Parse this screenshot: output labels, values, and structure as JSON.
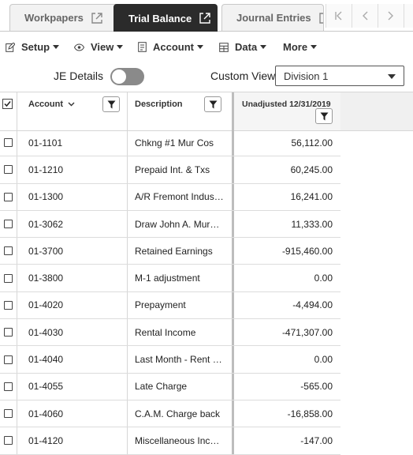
{
  "tabs": [
    {
      "label": "Workpapers",
      "active": false
    },
    {
      "label": "Trial Balance",
      "active": true
    },
    {
      "label": "Journal Entries",
      "active": false
    }
  ],
  "toolbar": {
    "setup": "Setup",
    "view": "View",
    "account": "Account",
    "data": "Data",
    "more": "More"
  },
  "options": {
    "je_details_label": "JE Details",
    "je_details_on": false,
    "custom_view_label": "Custom View",
    "custom_view_value": "Division 1"
  },
  "grid": {
    "columns": {
      "account": "Account",
      "description": "Description",
      "value": "Unadjusted 12/31/2019"
    },
    "rows": [
      {
        "account": "01-1101",
        "description": "Chkng #1 Mur Cos",
        "value": "56,112.00"
      },
      {
        "account": "01-1210",
        "description": "Prepaid Int. & Txs",
        "value": "60,245.00"
      },
      {
        "account": "01-1300",
        "description": "A/R Fremont Indus…",
        "value": "16,241.00"
      },
      {
        "account": "01-3062",
        "description": "Draw John A. Murphy",
        "value": "11,333.00"
      },
      {
        "account": "01-3700",
        "description": "Retained Earnings",
        "value": "-915,460.00"
      },
      {
        "account": "01-3800",
        "description": "M-1 adjustment",
        "value": "0.00"
      },
      {
        "account": "01-4020",
        "description": "Prepayment",
        "value": "-4,494.00"
      },
      {
        "account": "01-4030",
        "description": "Rental Income",
        "value": "-471,307.00"
      },
      {
        "account": "01-4040",
        "description": "Last Month - Rent I…",
        "value": "0.00"
      },
      {
        "account": "01-4055",
        "description": "Late Charge",
        "value": "-565.00"
      },
      {
        "account": "01-4060",
        "description": "C.A.M. Charge back",
        "value": "-16,858.00"
      },
      {
        "account": "01-4120",
        "description": "Miscellaneous Inco…",
        "value": "-147.00"
      }
    ]
  },
  "colors": {
    "active_tab": "#2b2b2b",
    "toggle_off": "#8a8a8a"
  }
}
